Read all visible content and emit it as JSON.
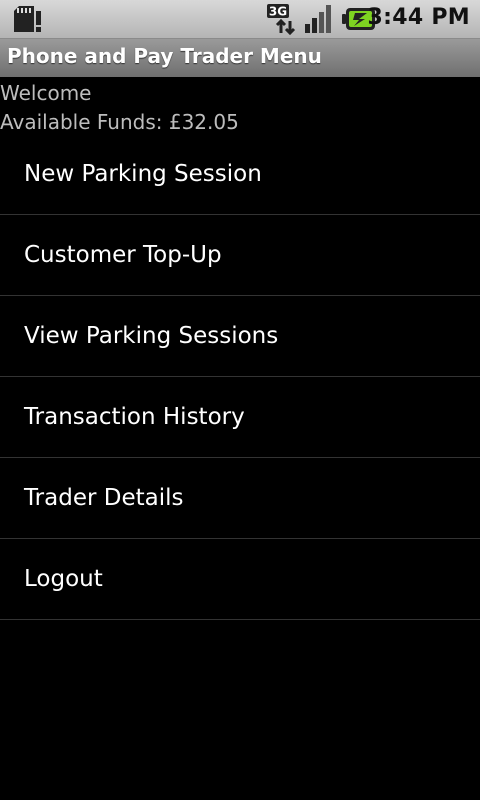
{
  "status_bar": {
    "time": "3:44 PM",
    "network_label": "3G",
    "icons": [
      "sd-card-icon",
      "network-3g-icon",
      "signal-icon",
      "battery-charging-icon"
    ]
  },
  "app": {
    "title": "Phone and Pay Trader Menu"
  },
  "account": {
    "welcome": "Welcome",
    "funds": "Available Funds: £32.05"
  },
  "menu": {
    "items": [
      {
        "label": "New Parking Session"
      },
      {
        "label": "Customer Top-Up"
      },
      {
        "label": "View Parking Sessions"
      },
      {
        "label": "Transaction History"
      },
      {
        "label": "Trader Details"
      },
      {
        "label": "Logout"
      }
    ]
  },
  "colors": {
    "background": "#000000",
    "title_bar": "#8a8a8a",
    "status_bar": "#c8c8c8",
    "battery_accent": "#7ed321"
  }
}
